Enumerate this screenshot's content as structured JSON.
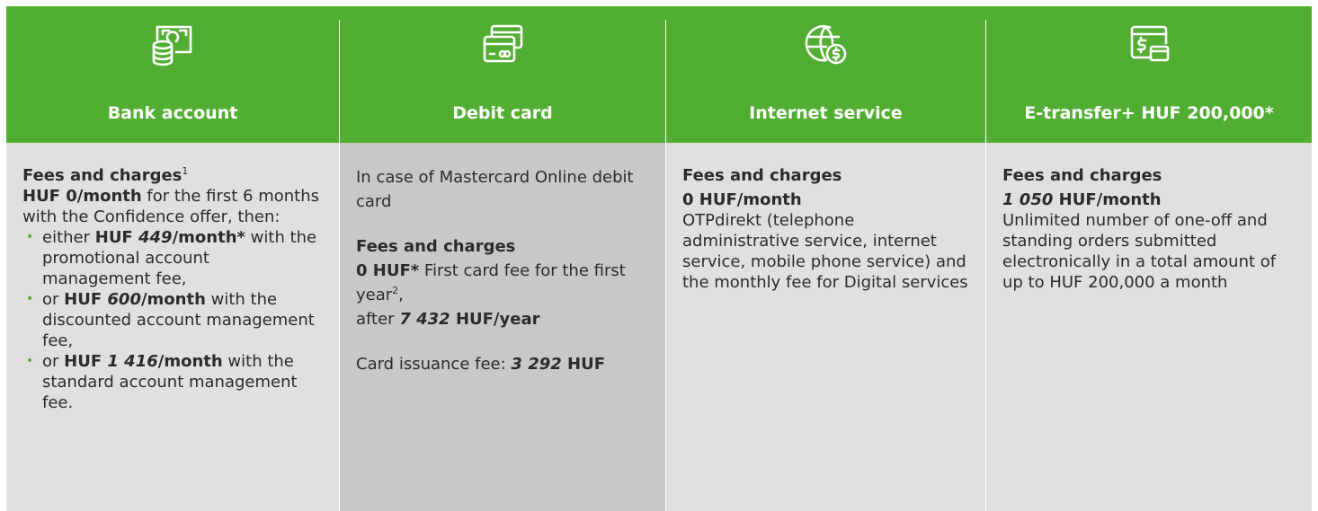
{
  "columns": [
    {
      "title": "Bank account",
      "icon": "cash-coins-icon"
    },
    {
      "title": "Debit card",
      "icon": "credit-cards-icon"
    },
    {
      "title": "Internet service",
      "icon": "globe-dollar-icon"
    },
    {
      "title": "E-transfer+ HUF 200,000*",
      "icon": "screen-dollar-card-icon"
    }
  ],
  "bank_account": {
    "fees_heading": "Fees and charges",
    "fees_sup": "1",
    "free_months": "HUF 0/month",
    "free_text": " for the first 6 months with the Confidence offer, then:",
    "options": [
      {
        "prefix": "either ",
        "cur": "HUF ",
        "amount": "449",
        "unit": "/month",
        "star": "*",
        "text": " with the promotional account management fee,"
      },
      {
        "prefix": "or ",
        "cur": "HUF ",
        "amount": "600",
        "unit": "/month",
        "star": "",
        "text": " with the discounted account management fee,"
      },
      {
        "prefix": "or ",
        "cur": "HUF ",
        "amount": "1 416",
        "unit": "/month",
        "star": "",
        "text": " with the standard account management fee."
      }
    ]
  },
  "debit_card": {
    "intro": "In case of Mastercard Online debit card",
    "fees_heading": "Fees and charges",
    "first_fee_value": "0 HUF*",
    "first_fee_text": " First card fee for the first year",
    "first_fee_sup": "2",
    "first_fee_comma": ",",
    "after_prefix": "after ",
    "after_amount": "7 432",
    "after_unit": " HUF/year",
    "issuance_label": "Card issuance fee: ",
    "issuance_amount": "3 292",
    "issuance_unit": " HUF"
  },
  "internet_service": {
    "fees_heading": "Fees and charges",
    "fee_value": "0 HUF/month",
    "description": "OTPdirekt (telephone administrative service, internet service, mobile phone service) and the monthly fee for Digital services"
  },
  "etransfer": {
    "fees_heading": "Fees and charges",
    "fee_amount": "1 050",
    "fee_unit": " HUF/month",
    "description": "Unlimited number of one-off and standing orders submitted electronically in a total amount of up to HUF 200,000 a month"
  },
  "colors": {
    "accent": "#52ae32",
    "body_bg": "#e0e0e0",
    "highlight_bg": "#c8c8c8"
  }
}
